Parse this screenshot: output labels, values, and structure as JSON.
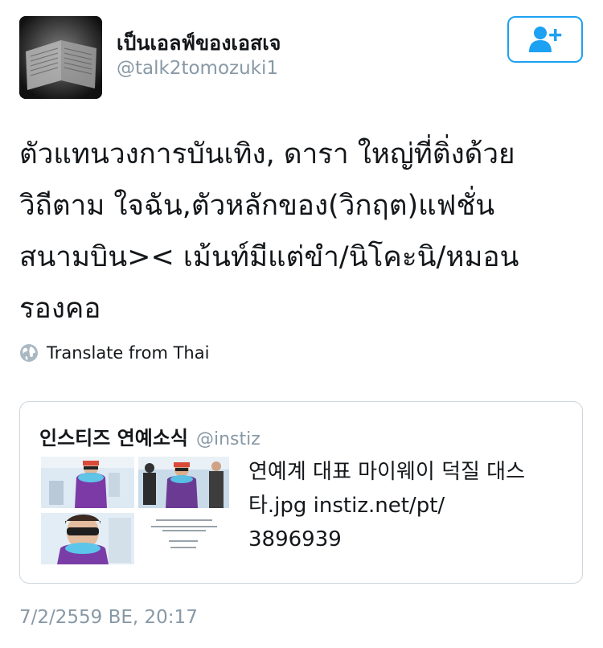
{
  "user": {
    "display_name": "เป็นเอลฟ์ของเอสเจ",
    "handle": "@talk2tomozuki1",
    "avatar_icon": "avatar-photo-book"
  },
  "follow_button": {
    "icon": "add-user-icon",
    "color": "#1da1f2"
  },
  "tweet": {
    "lines": [
      "ตัวแทนวงการบันเทิง, ดารา ใหญ่ที่ติ่งด้วย",
      "วิถีตาม ใจฉัน,ตัวหลักของ(วิกฤต)แฟชั่น",
      "สนามบิน>< เม้นท์มีแต่ขำ/นิโคะนิ/หมอน",
      "รองคอ"
    ]
  },
  "translate": {
    "icon": "globe-icon",
    "label": "Translate from Thai"
  },
  "quoted": {
    "name": "인스티즈 연예소식",
    "handle": "@instiz",
    "text_lines": [
      "연예계 대표 마이웨이 덕질 대스",
      "타.jpg instiz.net/pt/",
      "3896939"
    ]
  },
  "timestamp": "7/2/2559 BE, 20:17",
  "colors": {
    "accent": "#1da1f2",
    "secondary_text": "#8899a6",
    "border": "#cdd6dd"
  }
}
